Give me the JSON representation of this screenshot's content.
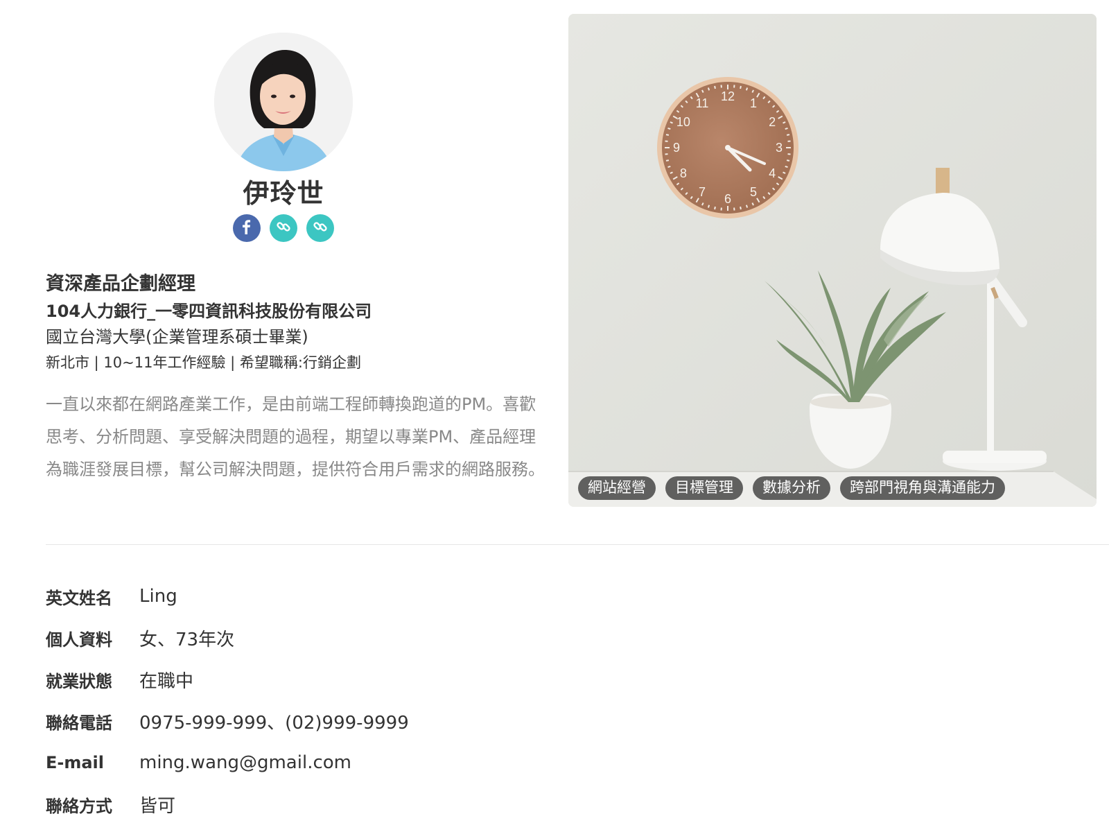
{
  "profile": {
    "name": "伊玲世",
    "socials": [
      {
        "type": "facebook",
        "icon": "facebook-icon"
      },
      {
        "type": "link",
        "icon": "link-icon"
      },
      {
        "type": "link",
        "icon": "link-icon"
      }
    ],
    "title": "資深產品企劃經理",
    "company": "104人力銀行_一零四資訊科技股份有限公司",
    "school": "國立台灣大學(企業管理系碩士畢業)",
    "meta": "新北市 | 10~11年工作經驗 | 希望職稱:行銷企劃",
    "bio": "一直以來都在網路產業工作，是由前端工程師轉換跑道的PM。喜歡思考、分析問題、享受解決問題的過程，期望以專業PM、產品經理為職涯發展目標，幫公司解決問題，提供符合用戶需求的網路服務。"
  },
  "photo": {
    "tags": [
      "網站經營",
      "目標管理",
      "數據分析",
      "跨部門視角與溝通能力"
    ],
    "clock_numbers": [
      "12",
      "1",
      "2",
      "3",
      "4",
      "5",
      "6",
      "7",
      "8",
      "9",
      "10",
      "11"
    ]
  },
  "info": [
    {
      "label": "英文姓名",
      "value": "Ling"
    },
    {
      "label": "個人資料",
      "value": "女、73年次"
    },
    {
      "label": "就業狀態",
      "value": "在職中"
    },
    {
      "label": "聯絡電話",
      "value": "0975-999-999、(02)999-9999"
    },
    {
      "label": "E-mail",
      "value": "ming.wang@gmail.com"
    },
    {
      "label": "聯絡方式",
      "value": "皆可"
    }
  ],
  "colors": {
    "facebook": "#4a69ad",
    "link": "#3cc6c2",
    "tag_bg": "#464646"
  }
}
